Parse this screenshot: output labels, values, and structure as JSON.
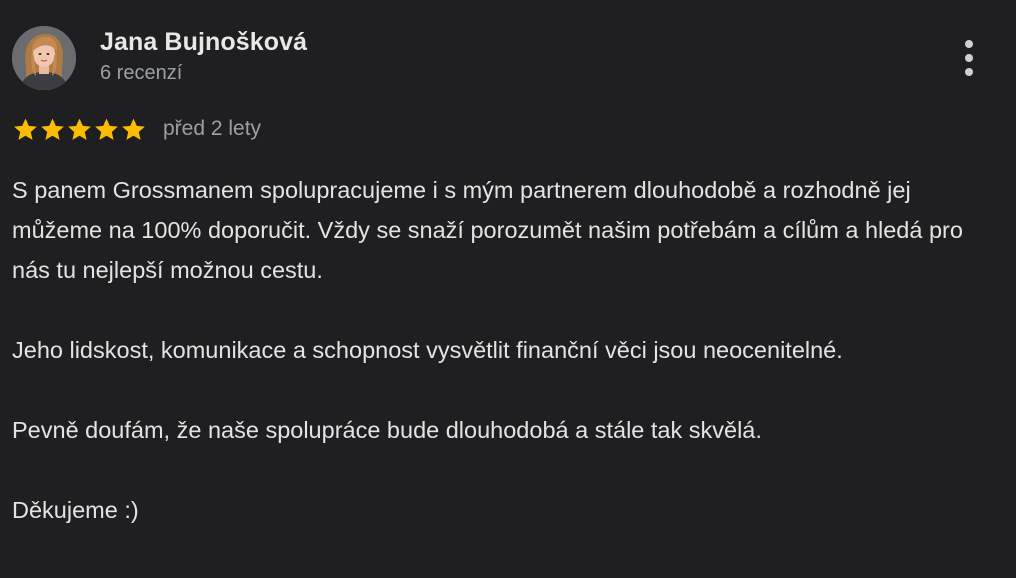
{
  "review": {
    "author_name": "Jana Bujnošková",
    "review_count": "6 recenzí",
    "rating": 5,
    "rating_max": 5,
    "star_color": "#fbbc04",
    "date": "před 2 lety",
    "paragraphs": [
      "S panem Grossmanem spolupracujeme i s mým partnerem dlouhodobě a rozhodně jej můžeme na 100% doporučit. Vždy se snaží porozumět našim potřebám a cílům a hledá pro nás tu nejlepší možnou cestu.",
      "Jeho lidskost, komunikace a schopnost vysvětlit finanční věci jsou neocenitelné.",
      "Pevně doufám, že naše spolupráce bude dlouhodobá a stále tak skvělá.",
      "Děkujeme :)"
    ]
  },
  "icons": {
    "avatar": "profile-photo",
    "menu": "more-vert-icon",
    "star": "star-icon"
  }
}
